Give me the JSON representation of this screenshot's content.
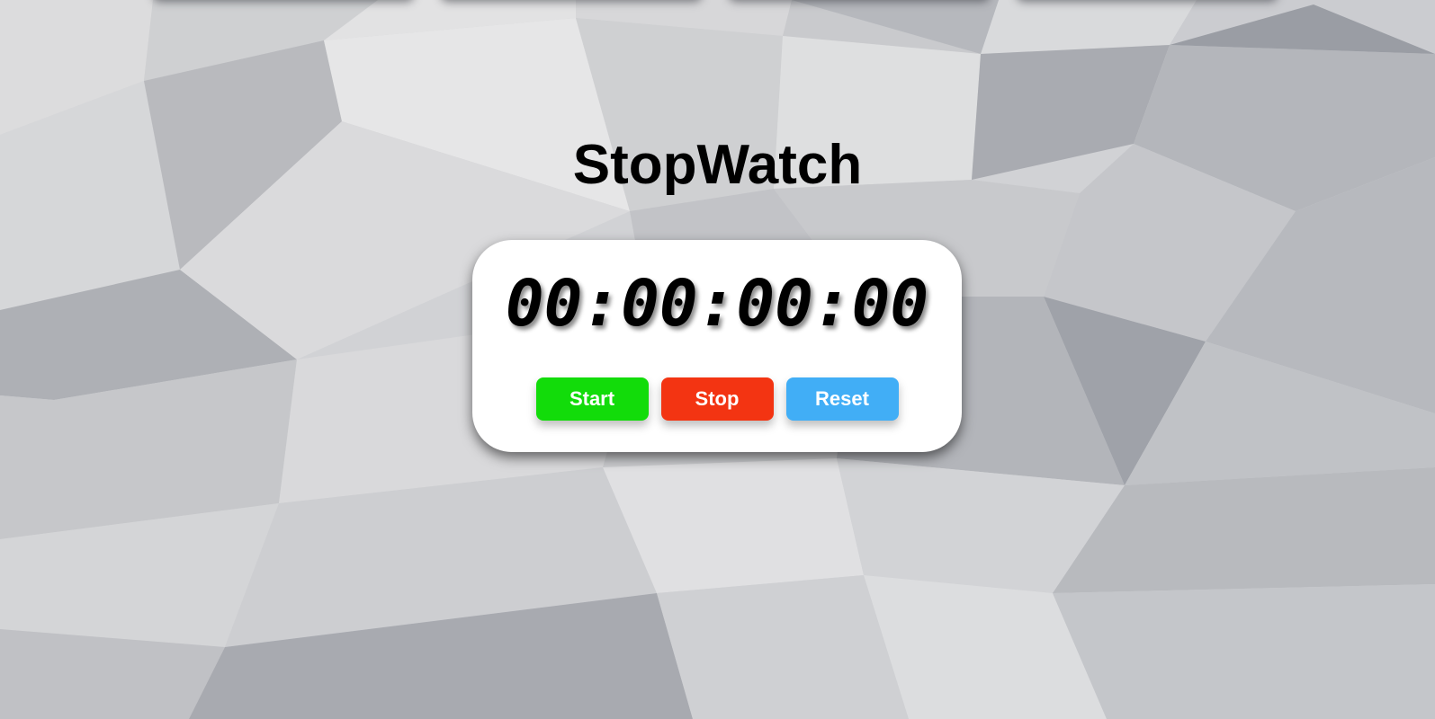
{
  "page": {
    "title": "StopWatch"
  },
  "stopwatch": {
    "display": "00:00:00:00",
    "buttons": {
      "start_label": "Start",
      "stop_label": "Stop",
      "reset_label": "Reset"
    }
  },
  "colors": {
    "start": "#12dc0a",
    "stop": "#f33412",
    "reset": "#41aef6",
    "card": "#ffffff"
  }
}
